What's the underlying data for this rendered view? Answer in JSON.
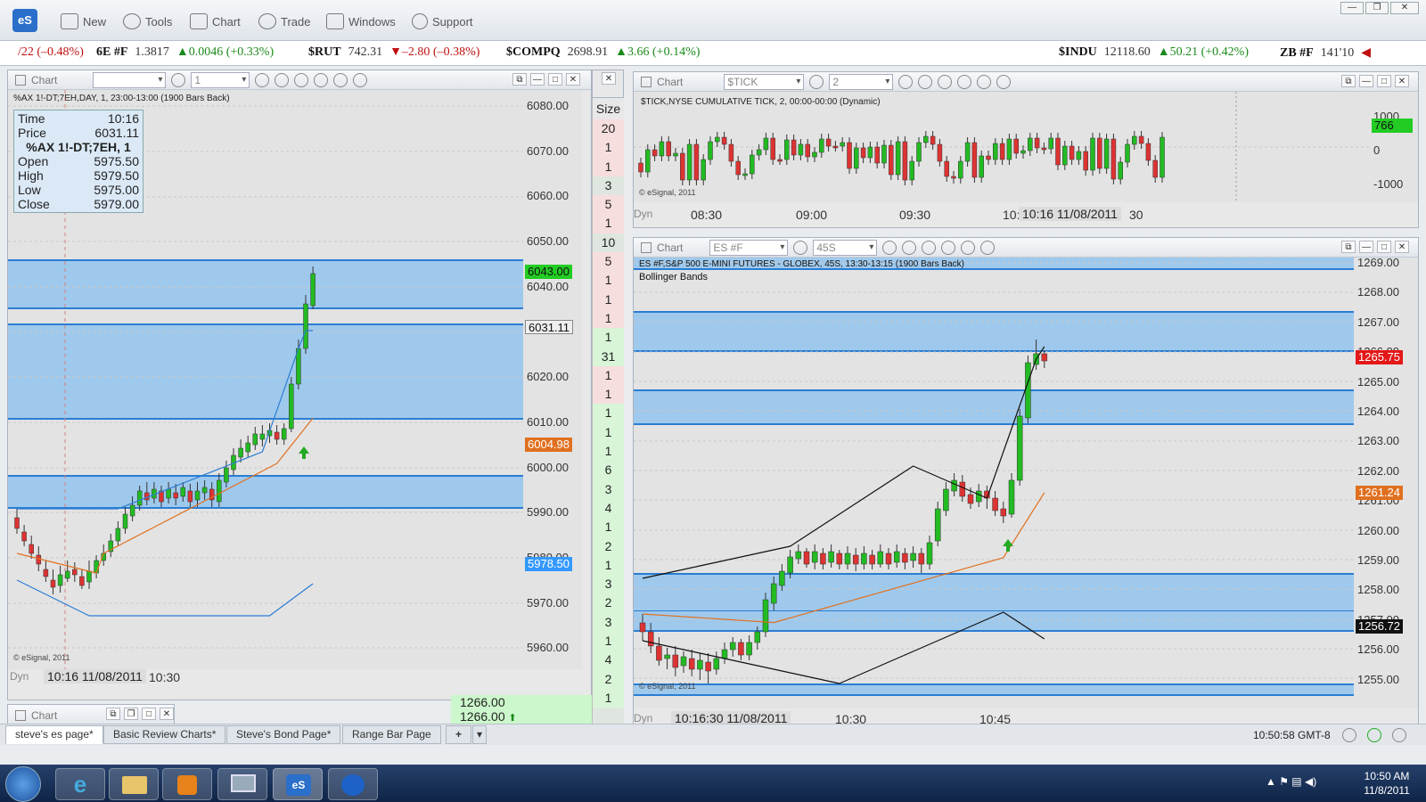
{
  "app": {
    "logo": "eS"
  },
  "toolbar": {
    "items": [
      {
        "label": "New",
        "icon": "new-page-icon"
      },
      {
        "label": "Tools",
        "icon": "tools-icon"
      },
      {
        "label": "Chart",
        "icon": "chart-icon"
      },
      {
        "label": "Trade",
        "icon": "trade-icon"
      },
      {
        "label": "Windows",
        "icon": "windows-icon"
      },
      {
        "label": "Support",
        "icon": "help-icon"
      }
    ]
  },
  "ticker": [
    {
      "sym": "",
      "price": "",
      "chg": "/22 (–0.48%)",
      "dir": "dn"
    },
    {
      "sym": "6E #F",
      "price": "1.3817",
      "chg": "▲0.0046 (+0.33%)",
      "dir": "up"
    },
    {
      "sym": "$RUT",
      "price": "742.31",
      "chg": "▼–2.80 (–0.38%)",
      "dir": "dn"
    },
    {
      "sym": "$COMPQ",
      "price": "2698.91",
      "chg": "▲3.66 (+0.14%)",
      "dir": "up"
    },
    {
      "sym": "$INDU",
      "price": "12118.60",
      "chg": "▲50.21 (+0.42%)",
      "dir": "up"
    },
    {
      "sym": "ZB #F",
      "price": "141'10",
      "chg": "◀",
      "dir": "dn"
    }
  ],
  "chart_left": {
    "title": "Chart",
    "symbol": "",
    "interval": "1",
    "header": "%AX 1!-DT;7EH,DAY, 1, 23:00-13:00 (1900 Bars Back)",
    "info": {
      "time_label": "Time",
      "time": "10:16",
      "price_label": "Price",
      "price": "6031.11",
      "symbol": "%AX 1!-DT;7EH, 1",
      "open_label": "Open",
      "open": "5975.50",
      "high_label": "High",
      "high": "5979.50",
      "low_label": "Low",
      "low": "5975.00",
      "close_label": "Close",
      "close": "5979.00"
    },
    "y_labels": [
      "6080.00",
      "6070.00",
      "6060.00",
      "6050.00",
      "6040.00",
      "6020.00",
      "6010.00",
      "6000.00",
      "5990.00",
      "5980.00",
      "5970.00",
      "5960.00"
    ],
    "tags": {
      "last": "6043.00",
      "cursor": "6031.11",
      "mid": "6004.98",
      "lower": "5978.50"
    },
    "cursor_time": "10:16 11/08/2011",
    "x_labels": [
      "10:30"
    ],
    "copyright": "© eSignal, 2011",
    "dyn": "Dyn"
  },
  "dom": {
    "header": "Size",
    "sizes": [
      "20",
      "1",
      "1",
      "3",
      "5",
      "1",
      "10",
      "5",
      "1",
      "1",
      "1",
      "1",
      "31",
      "1",
      "1",
      "1",
      "1",
      "1",
      "6",
      "3",
      "4",
      "1",
      "2",
      "1",
      "3",
      "2",
      "3",
      "1",
      "4",
      "2",
      "1"
    ],
    "prices": [
      "1266.00",
      "1266.00"
    ]
  },
  "chart_tick": {
    "title": "Chart",
    "symbol": "$TICK",
    "interval": "2",
    "header": "$TICK,NYSE CUMULATIVE TICK, 2, 00:00-00:00 (Dynamic)",
    "y_labels": [
      "1000",
      "0",
      "-1000"
    ],
    "tag": "766",
    "x_labels": [
      "08:30",
      "09:00",
      "09:30",
      "10:"
    ],
    "cursor_time": "10:16 11/08/2011",
    "x_tail": "30",
    "copyright": "© eSignal, 2011",
    "dyn": "Dyn"
  },
  "chart_es": {
    "title": "Chart",
    "symbol": "ES #F",
    "interval": "45S",
    "header": "ES #F,S&P 500 E-MINI FUTURES - GLOBEX, 45S, 13:30-13:15 (1900 Bars Back)",
    "study": "Bollinger Bands",
    "y_labels": [
      "1269.00",
      "1268.00",
      "1267.00",
      "1266.00",
      "1265.00",
      "1264.00",
      "1263.00",
      "1262.00",
      "1261.00",
      "1260.00",
      "1259.00",
      "1258.00",
      "1257.00",
      "1256.00",
      "1255.00"
    ],
    "tags": {
      "last": "1265.75",
      "mid": "1261.24",
      "lower": "1256.72"
    },
    "cursor_time": "10:16:30 11/08/2011",
    "x_labels": [
      "10:30",
      "10:45"
    ],
    "copyright": "© eSignal, 2011",
    "dyn": "Dyn"
  },
  "mini_chart": {
    "title": "Chart"
  },
  "tabs": [
    "steve's es page*",
    "Basic Review Charts*",
    "Steve's Bond Page*",
    "Range Bar Page",
    "+"
  ],
  "status": {
    "clock": "10:50:58 GMT-8"
  },
  "taskbar": {
    "time": "10:50 AM",
    "date": "11/8/2011"
  },
  "colors": {
    "band": "#9fc9ec",
    "line": "#2a7dd4",
    "up": "#22bb22",
    "down": "#dd3333",
    "lasttag": "#22cc22",
    "mid": "#e07020",
    "lower": "#3399ff"
  }
}
